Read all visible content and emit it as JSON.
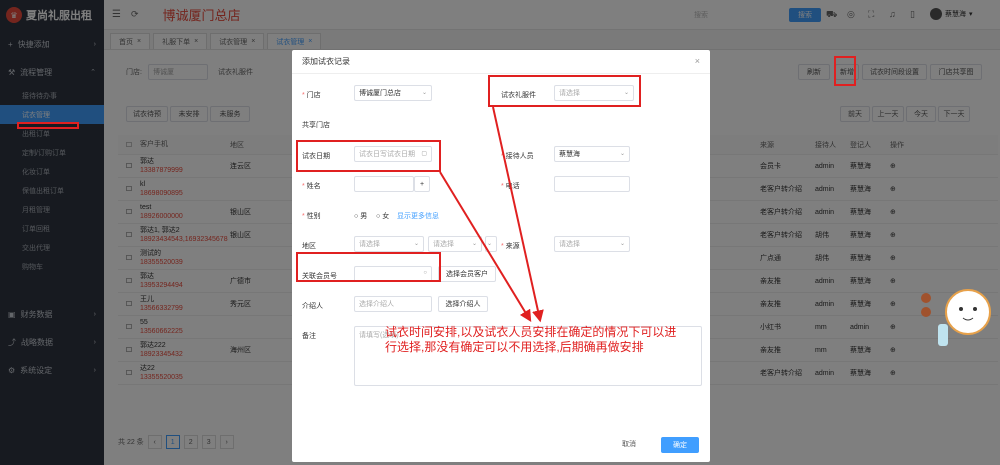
{
  "brand": {
    "name": "夏尚礼服出租"
  },
  "sidebar": {
    "groups": [
      {
        "label": "快捷添加",
        "icon": "plus-icon"
      },
      {
        "label": "流程管理",
        "icon": "wrench-icon"
      }
    ],
    "items": [
      "接待待办事",
      "试衣管理",
      "出租订单",
      "定制/订购订单",
      "化妆订单",
      "保值出租订单",
      "月租管理",
      "订单回租",
      "交出代理",
      "购物车"
    ],
    "active_index": 1,
    "groups_bottom": [
      {
        "label": "财务数据",
        "icon": "wallet-icon"
      },
      {
        "label": "战略数据",
        "icon": "chart-icon"
      },
      {
        "label": "系统设定",
        "icon": "gear-icon"
      }
    ]
  },
  "header": {
    "title": "博诚厦门总店",
    "search_placeholder": "搜索",
    "search_button": "搜索",
    "user": "蔡慧海"
  },
  "tabs": [
    "首页",
    "礼服下单",
    "试衣管理",
    "试衣管理"
  ],
  "filters": {
    "store_label": "门店:",
    "store_value": "博诚厦",
    "dress_label": "试衣礼服件"
  },
  "toolbar": {
    "refresh": "刷新",
    "add": "新增",
    "time_settings": "试衣时间段设置",
    "store_share": "门店共享图"
  },
  "status_tabs": [
    "试衣待预",
    "未安排",
    "未服务"
  ],
  "date_tabs": [
    "前天",
    "上一天",
    "今天",
    "下一天"
  ],
  "table": {
    "headers": [
      "客户手机",
      "地区",
      "来源",
      "接待人",
      "登记人",
      "操作"
    ],
    "rows": [
      {
        "name": "郭达",
        "phone": "13387879999",
        "area": "连云区",
        "source": "会员卡",
        "receiver": "admin",
        "register": "蔡慧海"
      },
      {
        "name": "kl",
        "phone": "18698090895",
        "area": "",
        "source": "老客户转介绍",
        "receiver": "admin",
        "register": "蔡慧海"
      },
      {
        "name": "test",
        "phone": "18926000000",
        "area": "银山区",
        "source": "老客户转介绍",
        "receiver": "admin",
        "register": "蔡慧海"
      },
      {
        "name": "郭达1, 郭达2",
        "phone": "18923434543,16932345678",
        "area": "银山区",
        "source": "老客户转介绍",
        "receiver": "胡伟",
        "register": "蔡慧海"
      },
      {
        "name": "测试的",
        "phone": "18355520039",
        "area": "",
        "source": "广点通",
        "receiver": "胡伟",
        "register": "蔡慧海"
      },
      {
        "name": "郭达",
        "phone": "13953294494",
        "area": "广德市",
        "source": "亲友推",
        "receiver": "admin",
        "register": "蔡慧海"
      },
      {
        "name": "王儿",
        "phone": "13566332799",
        "area": "秀元区",
        "source": "亲友推",
        "receiver": "admin",
        "register": "蔡慧海"
      },
      {
        "name": "55",
        "phone": "13560662225",
        "area": "",
        "source": "小红书",
        "receiver": "mm",
        "register": "admin"
      },
      {
        "name": "郭达222",
        "phone": "18923345432",
        "area": "海州区",
        "source": "亲友推",
        "receiver": "mm",
        "register": "蔡慧海"
      },
      {
        "name": "达22",
        "phone": "13355520035",
        "area": "",
        "source": "老客户转介绍",
        "receiver": "admin",
        "register": "蔡慧海"
      }
    ]
  },
  "pager": {
    "total": "共 22 条",
    "pages": [
      "1",
      "2",
      "3"
    ]
  },
  "dialog": {
    "title": "添加试衣记录",
    "store_label": "门店",
    "store_value": "博诚厦门总店",
    "dress_label": "试衣礼服件",
    "dress_placeholder": "请选择",
    "shared_store_label": "共享门店",
    "date_label": "试衣日期",
    "date_placeholder": "试衣日写试衣日期",
    "receiver_label": "接待人员",
    "receiver_value": "蔡慧海",
    "name_label": "姓名",
    "phone_label": "电话",
    "gender_label": "性别",
    "male": "男",
    "female": "女",
    "show_more": "显示更多信息",
    "area_label": "地区",
    "area_placeholder": "请选择",
    "source_label": "来源",
    "source_placeholder": "请选择",
    "member_label": "关联会员号",
    "member_button": "选择会员客户",
    "referrer_label": "介绍人",
    "referrer_placeholder": "选择介绍人",
    "referrer_button": "选择介绍人",
    "remark_label": "备注",
    "remark_placeholder": "请填写(选填)",
    "cancel": "取消",
    "confirm": "确定"
  },
  "annotation": {
    "text": "试衣时间安排,以及试衣人员安排在确定的情况下可以进行选择,那没有确定可以不用选择,后期确再做安排"
  },
  "colors": {
    "accent": "#409eff",
    "brand_red": "#e94b3c",
    "annotation": "#e02020",
    "sidebar": "#2f3540"
  }
}
